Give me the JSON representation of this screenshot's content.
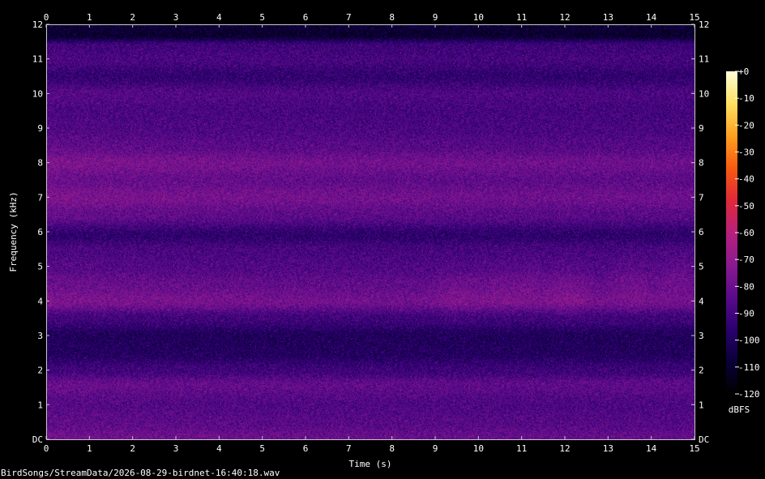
{
  "chart_data": {
    "type": "heatmap",
    "subtype": "spectrogram",
    "file_label": "BirdSongs/StreamData/2026-08-29-birdnet-16:40:18.wav",
    "xlabel": "Time (s)",
    "ylabel": "Frequency (kHz)",
    "xlim": [
      0,
      15
    ],
    "ylim": [
      0,
      12
    ],
    "x_ticks": [
      "0",
      "1",
      "2",
      "3",
      "4",
      "5",
      "6",
      "7",
      "8",
      "9",
      "10",
      "11",
      "12",
      "13",
      "14",
      "15"
    ],
    "y_ticks": [
      "DC",
      "1",
      "2",
      "3",
      "4",
      "5",
      "6",
      "7",
      "8",
      "9",
      "10",
      "11",
      "12"
    ],
    "colorbar": {
      "label": "dBFS",
      "range": [
        -120,
        0
      ],
      "ticks": [
        "+0",
        "-10",
        "-20",
        "-30",
        "-40",
        "-50",
        "-60",
        "-70",
        "-80",
        "-90",
        "-100",
        "-110",
        "-120"
      ],
      "colormap": [
        "#000000",
        "#0a0038",
        "#2a006e",
        "#5a0a8a",
        "#8a1a90",
        "#b8207a",
        "#e0283a",
        "#f85a10",
        "#ffa020",
        "#ffe060",
        "#ffffd8"
      ]
    },
    "frequency_band_profile_dbfs": [
      {
        "khz": 0.0,
        "db": -82
      },
      {
        "khz": 0.5,
        "db": -86
      },
      {
        "khz": 1.0,
        "db": -88
      },
      {
        "khz": 1.6,
        "db": -84
      },
      {
        "khz": 2.0,
        "db": -92
      },
      {
        "khz": 2.5,
        "db": -99
      },
      {
        "khz": 3.0,
        "db": -100
      },
      {
        "khz": 3.5,
        "db": -92
      },
      {
        "khz": 4.0,
        "db": -80
      },
      {
        "khz": 4.5,
        "db": -84
      },
      {
        "khz": 5.0,
        "db": -88
      },
      {
        "khz": 5.5,
        "db": -90
      },
      {
        "khz": 5.9,
        "db": -96
      },
      {
        "khz": 6.5,
        "db": -85
      },
      {
        "khz": 7.0,
        "db": -80
      },
      {
        "khz": 7.5,
        "db": -84
      },
      {
        "khz": 8.0,
        "db": -80
      },
      {
        "khz": 8.5,
        "db": -86
      },
      {
        "khz": 9.0,
        "db": -89
      },
      {
        "khz": 9.5,
        "db": -90
      },
      {
        "khz": 10.0,
        "db": -88
      },
      {
        "khz": 10.5,
        "db": -95
      },
      {
        "khz": 11.0,
        "db": -90
      },
      {
        "khz": 11.4,
        "db": -92
      },
      {
        "khz": 11.7,
        "db": -110
      },
      {
        "khz": 12.0,
        "db": -108
      }
    ],
    "time_modulation": {
      "early_boost_db": 5,
      "decay_seconds": 7
    },
    "call_blobs": [
      {
        "t": 9.5,
        "khz": 4.2,
        "db_boost": 4
      },
      {
        "t": 10.4,
        "khz": 4.3,
        "db_boost": 3
      },
      {
        "t": 11.1,
        "khz": 4.5,
        "db_boost": 4
      },
      {
        "t": 12.1,
        "khz": 4.3,
        "db_boost": 6
      },
      {
        "t": 13.5,
        "khz": 4.5,
        "db_boost": 5
      },
      {
        "t": 14.6,
        "khz": 4.7,
        "db_boost": 5
      }
    ]
  }
}
